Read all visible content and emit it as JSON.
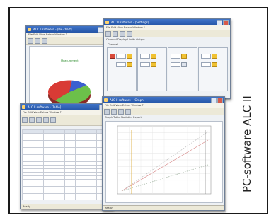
{
  "caption": "PC-software ALC II",
  "windows": {
    "pie_window": {
      "title": "ALC II software - [Pie chart]",
      "menu": "File  Edit  View  Extras  Window  ?",
      "label": "Measurement"
    },
    "settings_window": {
      "title": "ALC II software - [Settings]",
      "menu": "File  Edit  View  Extras  Window  ?",
      "tabs": "Channel   Display   Limits   Output",
      "section": "Channel"
    },
    "table_window": {
      "title": "ALC II software - [Table]",
      "menu": "File  Edit  View  Extras  Window  ?",
      "status": "Ready"
    },
    "graph_window": {
      "title": "ALC II software - [Graph]",
      "menu": "File  Edit  View  Extras  Window  ?",
      "tabs": "Graph   Table   Statistics   Export",
      "status": "Ready"
    }
  },
  "pie_chart_data": {
    "type": "pie",
    "colors": [
      "#6cc04a",
      "#d93b35",
      "#3b5fd0"
    ]
  },
  "colors": {
    "titlebar": "#2f63b8",
    "frame": "#1a1a1a",
    "highlight": "#f1c232"
  }
}
